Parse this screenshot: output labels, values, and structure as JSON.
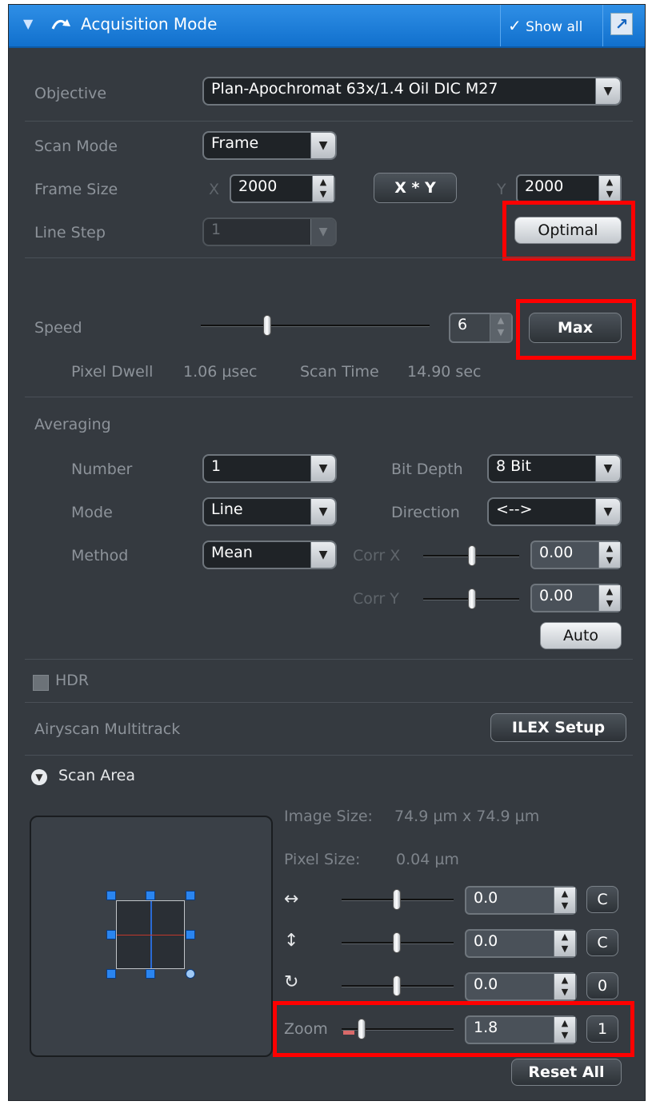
{
  "window": {
    "title": "Acquisition Mode",
    "show_all": "Show all",
    "accent": "#1a7ad9"
  },
  "objective": {
    "label": "Objective",
    "value": "Plan-Apochromat 63x/1.4 Oil DIC M27"
  },
  "scan": {
    "scan_mode_label": "Scan Mode",
    "scan_mode_value": "Frame",
    "frame_size_label": "Frame Size",
    "x_label": "X",
    "x_value": "2000",
    "xy_button": "X * Y",
    "y_label": "Y",
    "y_value": "2000",
    "line_step_label": "Line Step",
    "line_step_value": "1",
    "optimal_button": "Optimal"
  },
  "speed": {
    "label": "Speed",
    "value": "6",
    "level": 0.29,
    "max_button": "Max",
    "pixel_dwell_label": "Pixel Dwell",
    "pixel_dwell_value": "1.06 µsec",
    "scan_time_label": "Scan Time",
    "scan_time_value": "14.90 sec"
  },
  "averaging": {
    "heading": "Averaging",
    "number_label": "Number",
    "number_value": "1",
    "mode_label": "Mode",
    "mode_value": "Line",
    "method_label": "Method",
    "method_value": "Mean",
    "bit_depth_label": "Bit Depth",
    "bit_depth_value": "8 Bit",
    "direction_label": "Direction",
    "direction_value": "<-->",
    "corr_x_label": "Corr X",
    "corr_x_value": "0.00",
    "corr_y_label": "Corr Y",
    "corr_y_value": "0.00",
    "auto_button": "Auto"
  },
  "hdr": {
    "label": "HDR"
  },
  "airyscan": {
    "label": "Airyscan Multitrack",
    "ilex_button": "ILEX Setup"
  },
  "scan_area": {
    "heading": "Scan Area",
    "image_size_label": "Image Size:",
    "image_size_value": "74.9  µm x 74.9  µm",
    "pixel_size_label": "Pixel Size:",
    "pixel_size_value": "0.04 µm",
    "offset_x_value": "0.0",
    "offset_x_reset": "C",
    "offset_y_value": "0.0",
    "offset_y_reset": "C",
    "rotation_value": "0.0",
    "rotation_reset": "0",
    "zoom_label": "Zoom",
    "zoom_value": "1.8",
    "zoom_reset": "1",
    "reset_all_button": "Reset All"
  },
  "icons": {
    "horizontal": "↔",
    "vertical": "↕",
    "rotate": "↻",
    "check": "✓",
    "undock": "↗"
  },
  "highlight_color": "#ff0000"
}
